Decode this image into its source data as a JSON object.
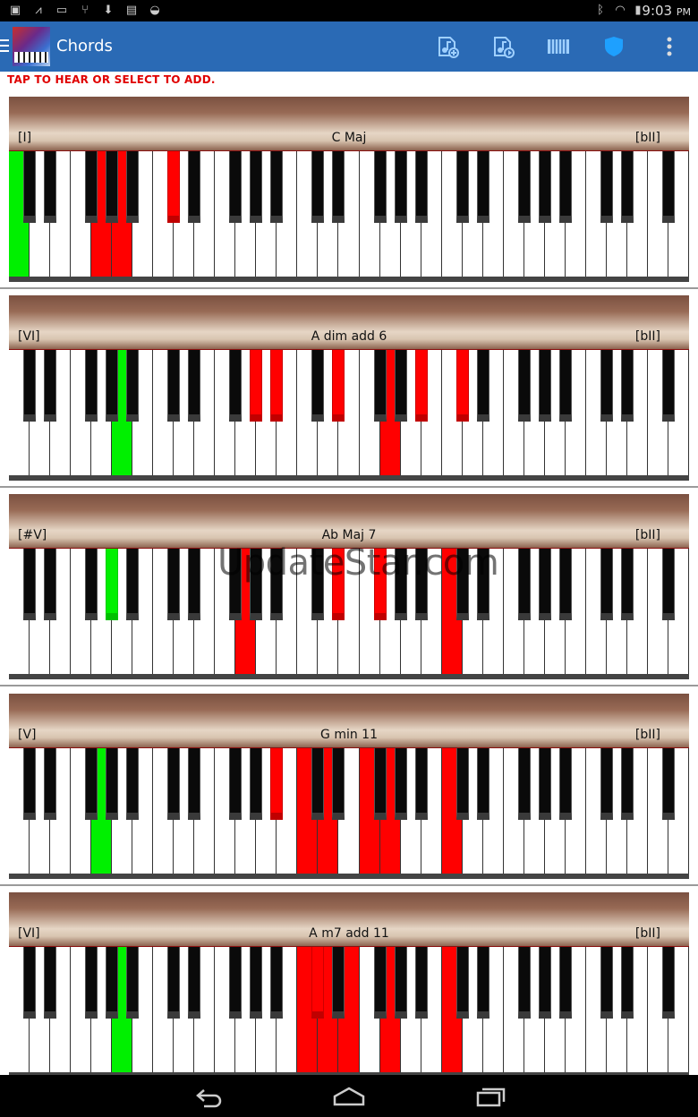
{
  "status_bar": {
    "time": "9:03",
    "ampm": "PM"
  },
  "action_bar": {
    "title": "Chords"
  },
  "hint": "TAP TO HEAR OR SELECT TO ADD.",
  "watermark": "UpdateStar.com",
  "colors": {
    "action_bar": "#2a6ab5",
    "active_key": "#ff0000",
    "root_key": "#00f000",
    "hint": "#e00000"
  },
  "icons": [
    "menu-icon",
    "app-logo-icon",
    "music-add-icon",
    "music-play-icon",
    "piano-icon",
    "shield-icon",
    "overflow-icon",
    "back-icon",
    "home-icon",
    "recents-icon"
  ],
  "chords": [
    {
      "numeral": "[I]",
      "name": "C  Maj",
      "tail": "[bII]",
      "root": 0,
      "notes": [
        0,
        7,
        9,
        13
      ]
    },
    {
      "numeral": "[VI]",
      "name": "A  dim add 6",
      "tail": "[bII]",
      "root": 9,
      "notes": [
        9,
        20,
        22,
        27,
        31,
        34,
        37
      ]
    },
    {
      "numeral": "[#V]",
      "name": "Ab  Maj 7",
      "tail": "[bII]",
      "root": 8,
      "notes": [
        8,
        19,
        27,
        30,
        36
      ]
    },
    {
      "numeral": "[V]",
      "name": "G  min 11",
      "tail": "[bII]",
      "root": 7,
      "notes": [
        7,
        22,
        24,
        26,
        29,
        31,
        36
      ]
    },
    {
      "numeral": "[VI]",
      "name": "A  m7 add 11",
      "tail": "[bII]",
      "root": 9,
      "notes": [
        9,
        24,
        25,
        26,
        28,
        31,
        36
      ]
    }
  ]
}
